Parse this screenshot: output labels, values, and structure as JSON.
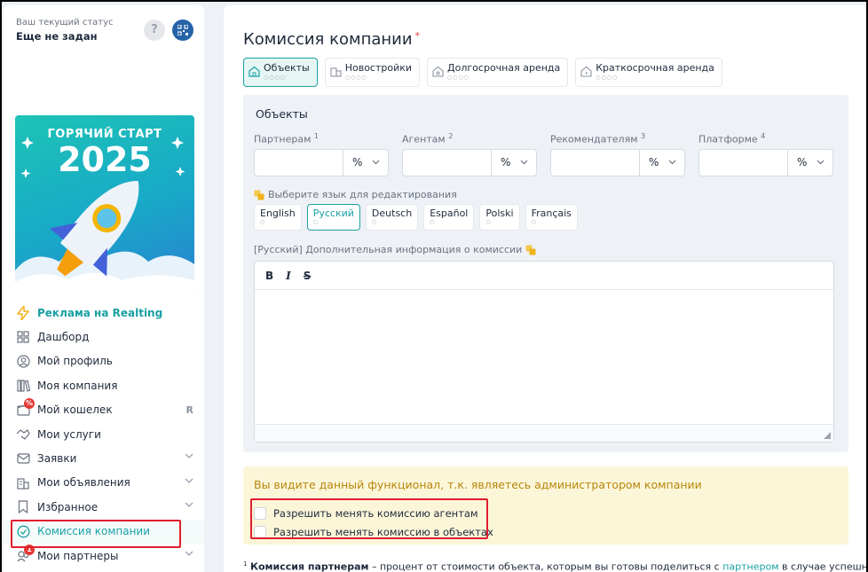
{
  "sidebar": {
    "status_label": "Ваш текущий статус",
    "status_value": "Еще не задан",
    "help_label": "?",
    "banner": {
      "line1": "ГОРЯЧИЙ СТАРТ",
      "line2": "2025"
    },
    "items": [
      {
        "label": "Реклама на Realting",
        "icon": "lightning-icon"
      },
      {
        "label": "Дашборд",
        "icon": "grid-icon"
      },
      {
        "label": "Мой профиль",
        "icon": "user-icon"
      },
      {
        "label": "Моя компания",
        "icon": "books-icon"
      },
      {
        "label": "Мой кошелек",
        "icon": "wallet-icon",
        "suffix": "R"
      },
      {
        "label": "Мои услуги",
        "icon": "handshake-icon"
      },
      {
        "label": "Заявки",
        "icon": "mail-icon"
      },
      {
        "label": "Мои объявления",
        "icon": "building-icon"
      },
      {
        "label": "Избранное",
        "icon": "bookmark-icon"
      },
      {
        "label": "Комиссия компании",
        "icon": "check-badge-icon"
      },
      {
        "label": "Мои партнеры",
        "icon": "partners-icon",
        "badge": "1"
      }
    ]
  },
  "main": {
    "title": "Комиссия компании",
    "required_mark": "*",
    "tabs": [
      {
        "label": "Объекты",
        "dots": "○○○○"
      },
      {
        "label": "Новостройки",
        "dots": "○○○○"
      },
      {
        "label": "Долгосрочная аренда",
        "dots": "○○○○"
      },
      {
        "label": "Краткосрочная аренда",
        "dots": "○○○○"
      }
    ],
    "panel_title": "Объекты",
    "fields": [
      {
        "label": "Партнерам",
        "sup": "1",
        "unit": "%"
      },
      {
        "label": "Агентам",
        "sup": "2",
        "unit": "%"
      },
      {
        "label": "Рекомендателям",
        "sup": "3",
        "unit": "%"
      },
      {
        "label": "Платформе",
        "sup": "4",
        "unit": "%"
      }
    ],
    "lang_hint": "Выберите язык для редактирования",
    "languages": [
      {
        "label": "English",
        "dot": "○"
      },
      {
        "label": "Русский",
        "dot": "○"
      },
      {
        "label": "Deutsch",
        "dot": "○"
      },
      {
        "label": "Español",
        "dot": "○"
      },
      {
        "label": "Polski",
        "dot": "○"
      },
      {
        "label": "Français",
        "dot": "○"
      }
    ],
    "info_label": "[Русский] Дополнительная информация о комиссии",
    "toolbar": {
      "bold": "B",
      "italic": "I",
      "strike": "S"
    },
    "admin_notice": "Вы видите данный функционал, т.к. являетесь администратором компании",
    "checkboxes": [
      {
        "label": "Разрешить менять комиссию агентам"
      },
      {
        "label": "Разрешить менять комиссию в объектах"
      }
    ],
    "footnote": {
      "sup": "1",
      "bold": "Комиссия партнерам",
      "text1": " – процент от стоимости объекта, которым вы готовы поделиться с ",
      "link": "партнером",
      "text2": " в случае успешно"
    }
  },
  "colors": {
    "accent": "#19a0a4",
    "highlight": "#e11d2e",
    "notice_bg": "#fcf6d9",
    "notice_text": "#b8860b"
  }
}
